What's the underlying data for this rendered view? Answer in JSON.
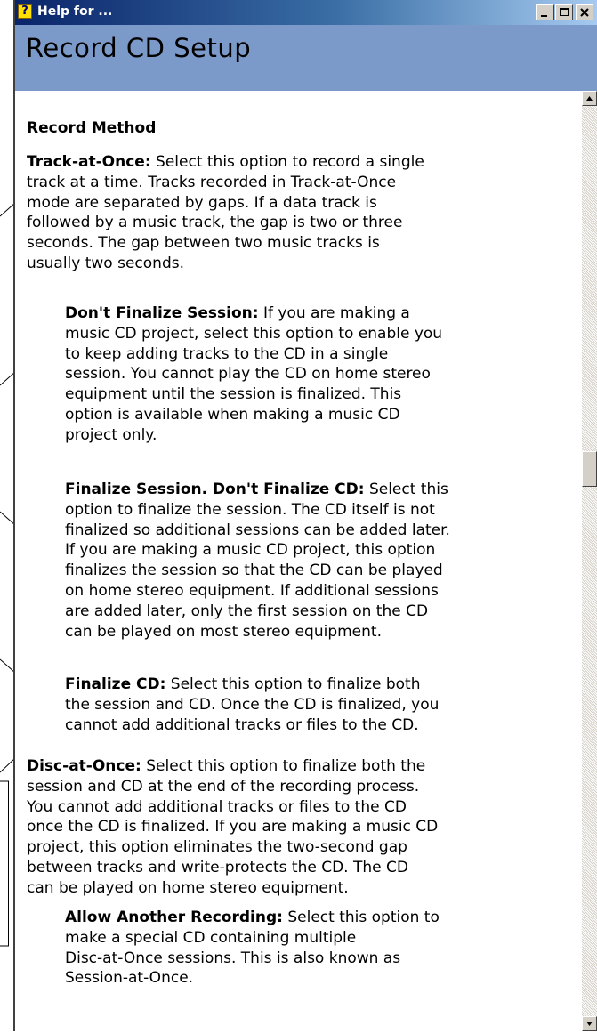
{
  "window": {
    "title": "Help for ...",
    "help_icon": "?",
    "controls": [
      "minimize-icon",
      "maximize-icon",
      "close-icon"
    ]
  },
  "header": {
    "title": "Record CD Setup"
  },
  "content": {
    "section_heading": "Record Method",
    "items": [
      {
        "term": "Track-at-Once:",
        "lines": [
          " Select this option to record a single",
          "track at a time. Tracks recorded in Track-at-Once",
          "mode are separated by gaps. If a data track is",
          "followed by a music track, the gap is two or three",
          "seconds. The gap between two music tracks is",
          "usually two seconds."
        ]
      },
      {
        "term": "Don't Finalize Session:",
        "lines": [
          " If you are making a",
          "music CD project, select this option to enable you",
          "to keep adding tracks to the CD in a single",
          "session. You cannot play the CD on home stereo",
          "equipment until the session is finalized. This",
          "option is available when making a music CD",
          "project only."
        ]
      },
      {
        "term": "Finalize Session. Don't Finalize CD:",
        "lines": [
          " Select this",
          "option to finalize the session. The CD itself is not",
          "finalized so additional sessions can be added later.",
          "If you are making a music CD project, this option",
          "finalizes the session so that the CD can be played",
          "on home stereo equipment. If additional sessions",
          "are added later, only the first session on the CD",
          "can be played on most stereo equipment."
        ]
      },
      {
        "term": "Finalize CD:",
        "lines": [
          " Select this option to finalize both",
          "the session and CD. Once the CD is finalized, you",
          "cannot add additional tracks or files to the CD."
        ]
      },
      {
        "term": "Disc-at-Once:",
        "lines": [
          " Select this option to finalize both the",
          "session and CD at the end of the recording process.",
          "You cannot add additional tracks or files to the CD",
          "once the CD is finalized. If you are making a music CD",
          "project, this option eliminates the two-second gap",
          "between tracks and write-protects the CD. The CD",
          "can be played on home stereo equipment."
        ]
      },
      {
        "term": "Allow Another Recording:",
        "lines": [
          " Select this option to",
          "make a special CD containing multiple",
          "Disc-at-Once sessions. This is also known as",
          "Session-at-Once."
        ]
      }
    ]
  },
  "scrollbar": {
    "up_icon": "scroll-up-arrow-icon",
    "down_icon": "scroll-down-arrow-icon",
    "position": 0.4
  }
}
